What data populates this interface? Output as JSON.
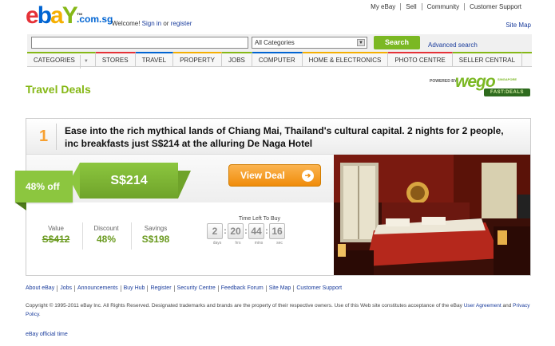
{
  "header": {
    "logo_letters": [
      "e",
      "b",
      "a",
      "Y"
    ],
    "logo_tm": "™",
    "domain": ".com.sg",
    "welcome": "Welcome!",
    "sign_in": "Sign in",
    "or_text": "or",
    "register": "register",
    "top_links": [
      "My eBay",
      "Sell",
      "Community",
      "Customer Support"
    ],
    "site_map": "Site Map"
  },
  "search": {
    "placeholder": "",
    "category": "All Categories",
    "button": "Search",
    "advanced": "Advanced search"
  },
  "nav": {
    "items": [
      {
        "label": "CATEGORIES",
        "color": "#86b817"
      },
      {
        "label": "STORES",
        "color": "#e53238"
      },
      {
        "label": "TRAVEL",
        "color": "#0064d2"
      },
      {
        "label": "PROPERTY",
        "color": "#f5af02"
      },
      {
        "label": "JOBS",
        "color": "#86b817"
      },
      {
        "label": "COMPUTER",
        "color": "#0064d2"
      },
      {
        "label": "HOME & ELECTRONICS",
        "color": "#f5af02"
      },
      {
        "label": "PHOTO CENTRE",
        "color": "#e53238"
      },
      {
        "label": "SELLER CENTRAL",
        "color": "#86b817"
      }
    ]
  },
  "page": {
    "title": "Travel Deals",
    "powered_by": "POWERED BY:",
    "brand": "wego",
    "brand_region": "SINGAPORE",
    "brand_badge": "FAST:DEALS"
  },
  "deal": {
    "rank": "1",
    "title": "Ease into the rich mythical lands of Chiang Mai, Thailand's cultural capital. 2 nights for 2 people, inc breakfasts just S$214 at the alluring De Naga Hotel",
    "discount_tag": "48% off",
    "price": "S$214",
    "view_button": "View Deal",
    "value_label": "Value",
    "value": "S$412",
    "discount_label": "Discount",
    "discount": "48%",
    "savings_label": "Savings",
    "savings": "S$198",
    "timer_label": "Time Left To Buy",
    "timer": {
      "days": "2",
      "hrs": "20",
      "mins": "44",
      "sec": "16"
    },
    "timer_units": {
      "days": "days",
      "hrs": "hrs",
      "mins": "mins",
      "sec": "sec"
    }
  },
  "footer": {
    "links": [
      "About eBay",
      "Jobs",
      "Announcements",
      "Buy Hub",
      "Register",
      "Security Centre",
      "Feedback Forum",
      "Site Map",
      "Customer Support"
    ],
    "copyright": "Copyright © 1995-2011 eBay Inc. All Rights Reserved. Designated trademarks and brands are the property of their respective owners. Use of this Web site constitutes acceptance of the eBay",
    "user_agreement": "User Agreement",
    "and_text": "and",
    "privacy": "Privacy Policy",
    "official_time": "eBay official time"
  }
}
